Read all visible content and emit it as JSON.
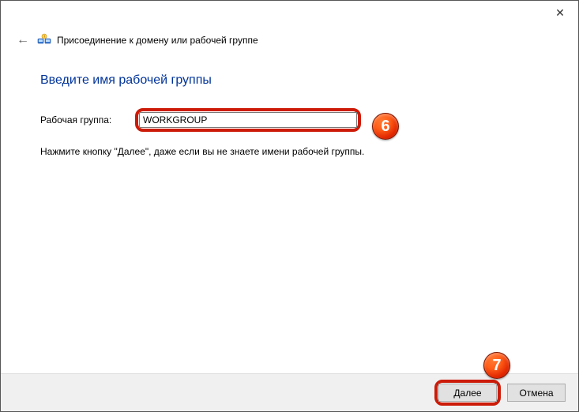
{
  "titlebar": {
    "close_glyph": "✕"
  },
  "header": {
    "back_glyph": "←",
    "wizard_title": "Присоединение к домену или рабочей группе"
  },
  "content": {
    "heading": "Введите имя рабочей группы",
    "label": "Рабочая группа:",
    "input_value": "WORKGROUP",
    "hint": "Нажмите кнопку \"Далее\", даже если вы не знаете имени рабочей группы."
  },
  "footer": {
    "next_label": "Далее",
    "cancel_label": "Отмена"
  },
  "badges": {
    "six": "6",
    "seven": "7"
  }
}
